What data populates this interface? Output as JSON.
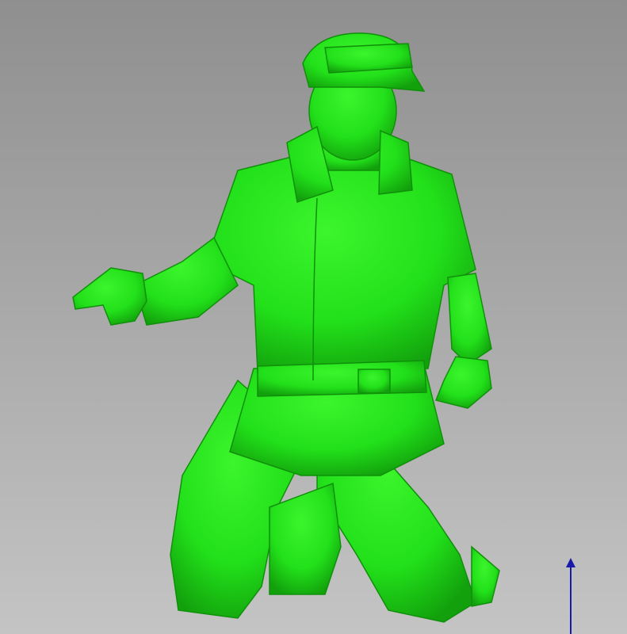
{
  "viewer": {
    "background_top": "#8f8f8f",
    "background_bottom": "#c4c4c4",
    "model_color": "#22e01a",
    "model_shade": "#15a80f",
    "axis_color": "#1a1aa8",
    "axis_label": "up-axis"
  }
}
